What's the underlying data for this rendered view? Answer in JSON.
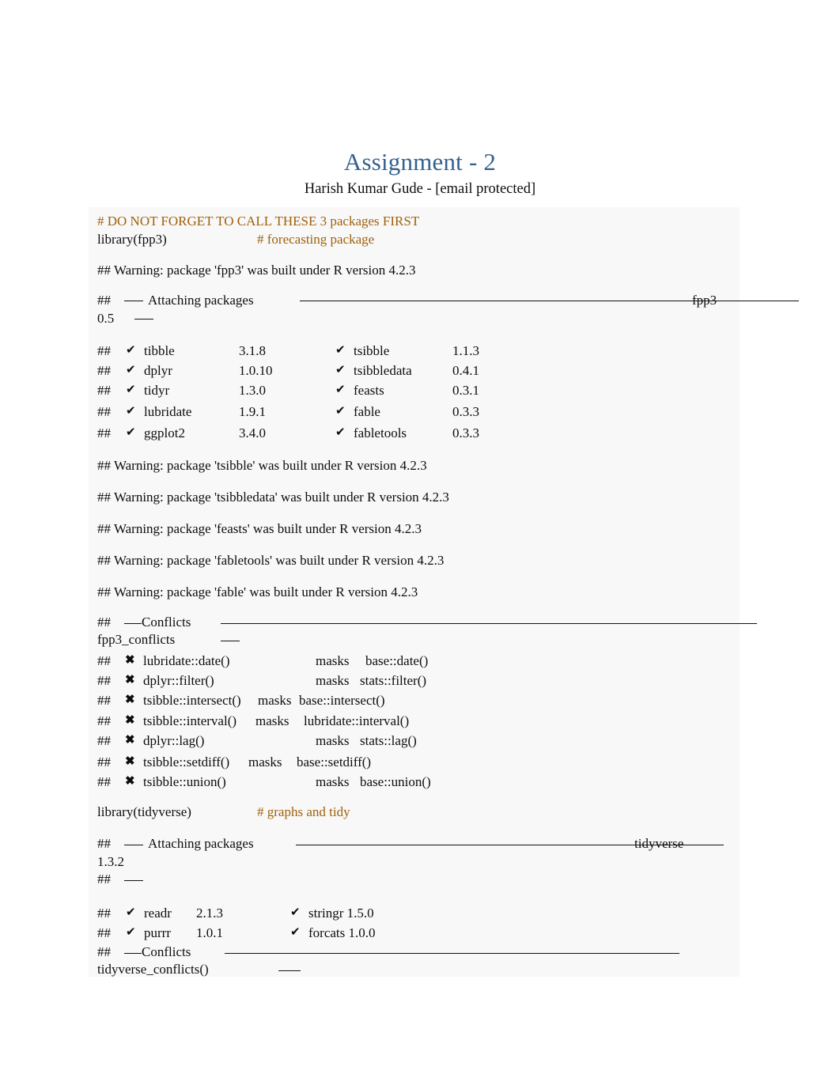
{
  "document": {
    "title": "Assignment - 2",
    "subtitle": "Harish Kumar Gude - [email protected]",
    "title_color": "#34618e",
    "comment_color": "#a0610a",
    "code_background": "#f8f8f8"
  },
  "code": {
    "comment_header": "# DO NOT FORGET TO CALL THESE 3 packages FIRST",
    "library_fpp3": "library(fpp3)",
    "comment_fpp3": "# forecasting package",
    "library_tidyverse": "library(tidyverse)",
    "comment_tidyverse": "# graphs and tidy"
  },
  "output": {
    "hash": "##",
    "warning_fpp3": "## Warning: package 'fpp3' was built under R version 4.2.3",
    "attaching_label": "Attaching packages",
    "fpp3_banner_name": "fpp3",
    "fpp3_banner_version": "0.5",
    "dash": "—",
    "dash_long": "——",
    "warnings": [
      "## Warning: package 'tsibble' was built under R version 4.2.3",
      "## Warning: package 'tsibbledata' was built under R version 4.2.3",
      "## Warning: package 'feasts' was built under R version 4.2.3",
      "## Warning: package 'fabletools' was built under R version 4.2.3",
      "## Warning: package 'fable' was built under R version 4.2.3"
    ],
    "check_icon": "✔",
    "cross_icon": "✖",
    "fpp3_packages_left": [
      {
        "name": "tibble",
        "version": "3.1.8"
      },
      {
        "name": "dplyr",
        "version": "1.0.10"
      },
      {
        "name": "tidyr",
        "version": "1.3.0"
      },
      {
        "name": "lubridate",
        "version": "1.9.1"
      },
      {
        "name": "ggplot2",
        "version": "3.4.0"
      }
    ],
    "fpp3_packages_right": [
      {
        "name": "tsibble",
        "version": "1.1.3"
      },
      {
        "name": "tsibbledata",
        "version": "0.4.1"
      },
      {
        "name": "feasts",
        "version": "0.3.1"
      },
      {
        "name": "fable",
        "version": "0.3.3"
      },
      {
        "name": "fabletools",
        "version": "0.3.3"
      }
    ],
    "conflicts_label": "Conflicts",
    "fpp3_conflicts_fn": "fpp3_conflicts",
    "fpp3_conflicts": [
      {
        "masked": "lubridate::date()",
        "masks": "masks",
        "by": "base::date()"
      },
      {
        "masked": "dplyr::filter()",
        "masks": "masks",
        "by": "stats::filter()"
      },
      {
        "masked": "tsibble::intersect()",
        "masks": "masks",
        "by": "base::intersect()"
      },
      {
        "masked": "tsibble::interval()",
        "masks": "masks",
        "by": "lubridate::interval()"
      },
      {
        "masked": "dplyr::lag()",
        "masks": "masks",
        "by": "stats::lag()"
      },
      {
        "masked": "tsibble::setdiff()",
        "masks": "masks",
        "by": "base::setdiff()"
      },
      {
        "masked": "tsibble::union()",
        "masks": "masks",
        "by": "base::union()"
      }
    ],
    "tidyverse_banner_name": "tidyverse",
    "tidyverse_banner_version": "1.3.2",
    "tidyverse_packages_left": [
      {
        "name": "readr",
        "version": "2.1.3"
      },
      {
        "name": "purrr",
        "version": "1.0.1"
      }
    ],
    "tidyverse_packages_right": [
      {
        "name": "stringr 1.5.0"
      },
      {
        "name": "forcats 1.0.0"
      }
    ],
    "tidyverse_conflicts_fn": "tidyverse_conflicts()"
  }
}
